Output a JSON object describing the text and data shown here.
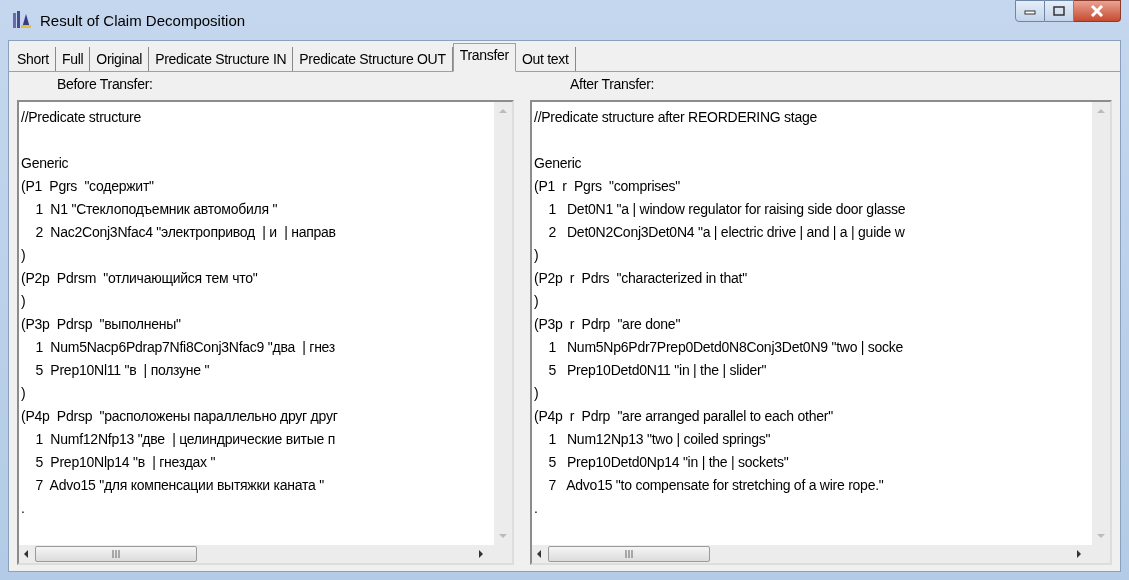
{
  "window": {
    "title": "Result of Claim Decomposition"
  },
  "tabs": [
    {
      "label": "Short",
      "selected": false
    },
    {
      "label": "Full",
      "selected": false
    },
    {
      "label": "Original",
      "selected": false
    },
    {
      "label": "Predicate Structure IN",
      "selected": false
    },
    {
      "label": "Predicate Structure OUT",
      "selected": false
    },
    {
      "label": "Transfer",
      "selected": true
    },
    {
      "label": "Out text",
      "selected": false
    }
  ],
  "panels": [
    {
      "label": "Before Transfer:",
      "lines": [
        {
          "kind": "text",
          "text": "//Predicate structure"
        },
        {
          "kind": "blank"
        },
        {
          "kind": "text",
          "text": "Generic"
        },
        {
          "kind": "text",
          "text": "(P1  Pgrs  \"содержит\""
        },
        {
          "kind": "text",
          "text": "    1  N1 \"Стеклоподъемник автомобиля \""
        },
        {
          "kind": "text",
          "text": "    2  Nac2Conj3Nfac4 \"электропривод  | и  | направ"
        },
        {
          "kind": "text",
          "text": ")"
        },
        {
          "kind": "text",
          "text": "(P2p  Pdrsm  \"отличающийся тем что\""
        },
        {
          "kind": "text",
          "text": ")"
        },
        {
          "kind": "text",
          "text": "(P3p  Pdrsp  \"выполнены\""
        },
        {
          "kind": "text",
          "text": "    1  Num5Nacp6Pdrap7Nfi8Conj3Nfac9 \"два  | гнез"
        },
        {
          "kind": "text",
          "text": "    5  Prep10Nl11 \"в  | ползуне \""
        },
        {
          "kind": "text",
          "text": ")"
        },
        {
          "kind": "text",
          "text": "(P4p  Pdrsp  \"расположены параллельно друг друг"
        },
        {
          "kind": "text",
          "text": "    1  Numf12Nfp13 \"две  | целиндрические витые п"
        },
        {
          "kind": "text",
          "text": "    5  Prep10Nlp14 \"в  | гнездах \""
        },
        {
          "kind": "text",
          "text": "    7  Advo15 \"для компенсации вытяжки каната \""
        },
        {
          "kind": "text",
          "text": "."
        }
      ]
    },
    {
      "label": "After Transfer:",
      "lines": [
        {
          "kind": "text",
          "text": "//Predicate structure after REORDERING stage"
        },
        {
          "kind": "blank"
        },
        {
          "kind": "text",
          "text": "Generic"
        },
        {
          "kind": "text",
          "text": "(P1  r  Pgrs  \"comprises\""
        },
        {
          "kind": "text",
          "text": "    1   Det0N1 \"a | window regulator for raising side door glasse"
        },
        {
          "kind": "text",
          "text": "    2   Det0N2Conj3Det0N4 \"a | electric drive | and | a | guide w"
        },
        {
          "kind": "text",
          "text": ")"
        },
        {
          "kind": "text",
          "text": "(P2p  r  Pdrs  \"characterized in that\""
        },
        {
          "kind": "text",
          "text": ")"
        },
        {
          "kind": "text",
          "text": "(P3p  r  Pdrp  \"are done\""
        },
        {
          "kind": "text",
          "text": "    1   Num5Np6Pdr7Prep0Detd0N8Conj3Det0N9 \"two | socke"
        },
        {
          "kind": "text",
          "text": "    5   Prep10Detd0N11 \"in | the | slider\""
        },
        {
          "kind": "text",
          "text": ")"
        },
        {
          "kind": "text",
          "text": "(P4p  r  Pdrp  \"are arranged parallel to each other\""
        },
        {
          "kind": "text",
          "text": "    1   Num12Np13 \"two | coiled springs\""
        },
        {
          "kind": "text",
          "text": "    5   Prep10Detd0Np14 \"in | the | sockets\""
        },
        {
          "kind": "text",
          "text": "    7   Advo15 \"to compensate for stretching of a wire rope.\""
        },
        {
          "kind": "text",
          "text": "."
        }
      ]
    }
  ]
}
